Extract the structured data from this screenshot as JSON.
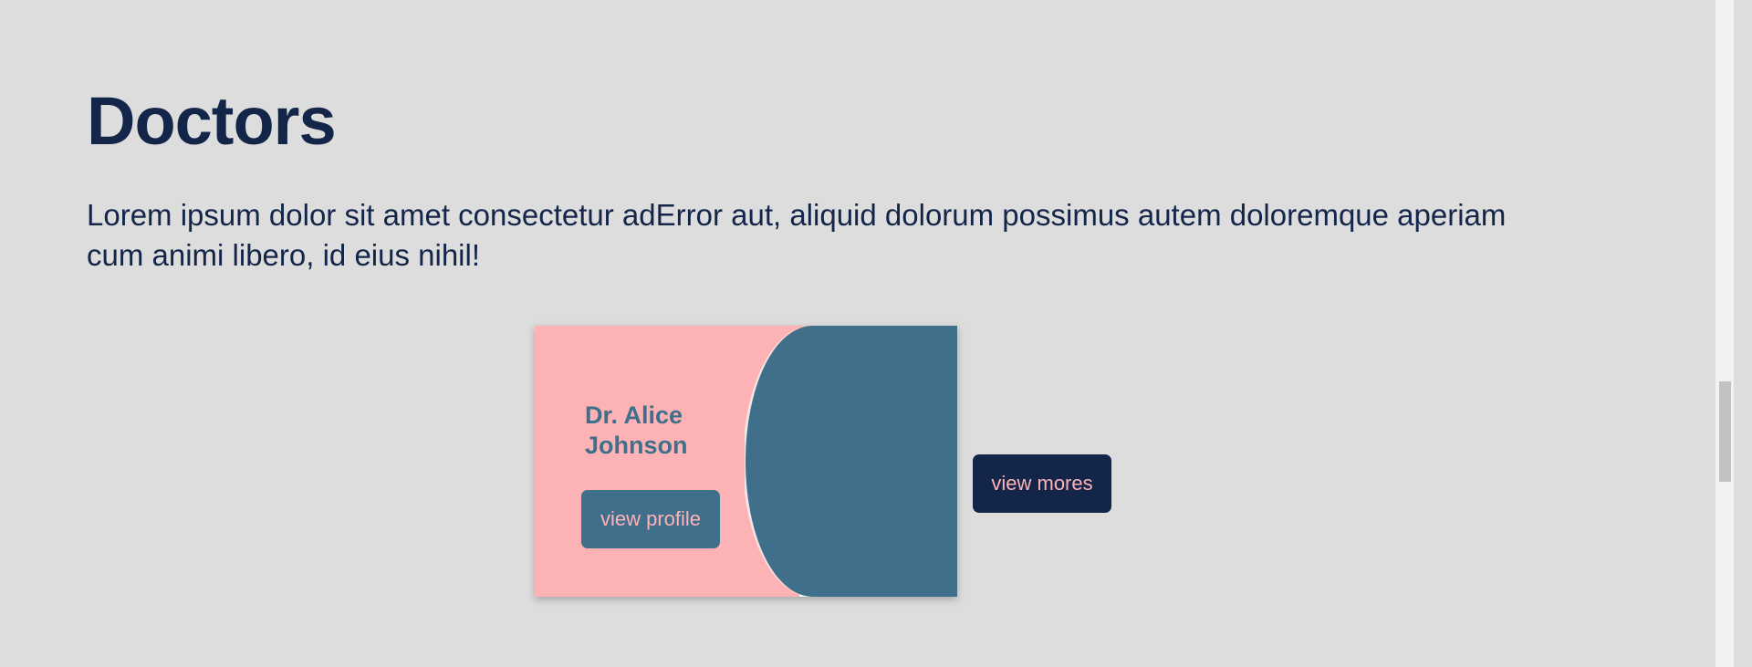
{
  "section": {
    "title": "Doctors",
    "intro": "Lorem ipsum dolor sit amet consectetur adError aut, aliquid dolorum possimus autem doloremque aperiam cum animi libero, id eius nihil!"
  },
  "doctor_card": {
    "name": "Dr. Alice Johnson",
    "profile_button": "view profile"
  },
  "more_button": "view mores",
  "colors": {
    "page_bg": "#dddddd",
    "title": "#14254a",
    "card_bg": "#fdb3b6",
    "accent_blue": "#3f6f8a",
    "dark_navy": "#14254a"
  }
}
